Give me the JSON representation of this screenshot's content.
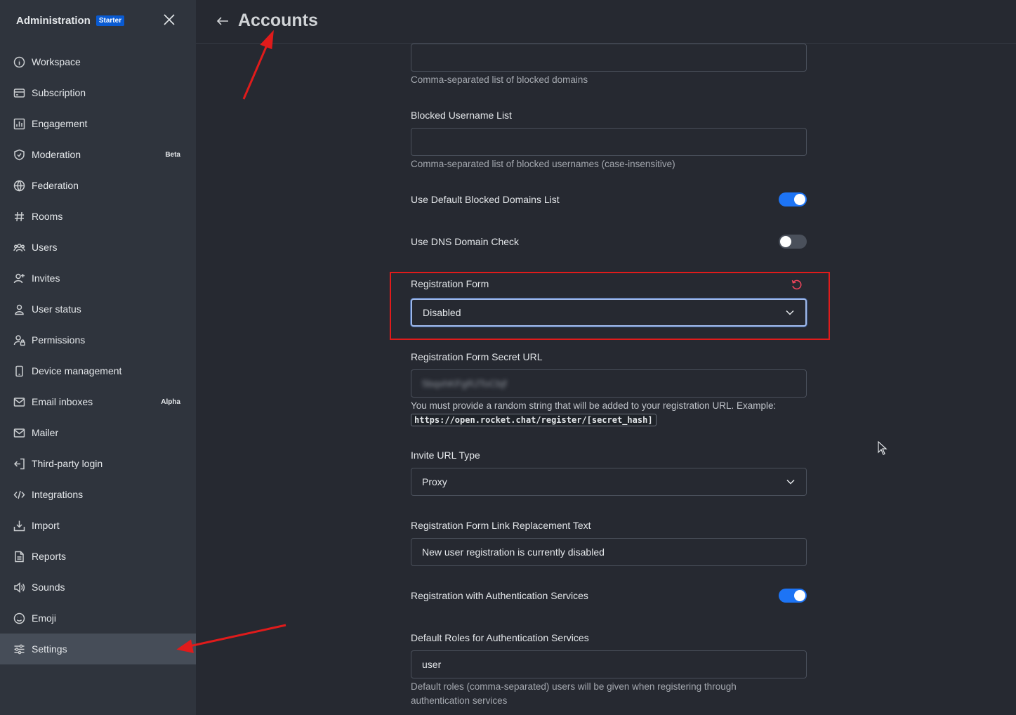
{
  "sidebar": {
    "title": "Administration",
    "badge": "Starter",
    "items": [
      {
        "label": "Workspace",
        "icon": "info-icon"
      },
      {
        "label": "Subscription",
        "icon": "card-icon"
      },
      {
        "label": "Engagement",
        "icon": "bar-chart-icon"
      },
      {
        "label": "Moderation",
        "icon": "shield-icon",
        "tag": "Beta"
      },
      {
        "label": "Federation",
        "icon": "globe-icon"
      },
      {
        "label": "Rooms",
        "icon": "hash-icon"
      },
      {
        "label": "Users",
        "icon": "team-icon"
      },
      {
        "label": "Invites",
        "icon": "user-plus-icon"
      },
      {
        "label": "User status",
        "icon": "user-icon"
      },
      {
        "label": "Permissions",
        "icon": "user-lock-icon"
      },
      {
        "label": "Device management",
        "icon": "mobile-icon"
      },
      {
        "label": "Email inboxes",
        "icon": "mail-icon",
        "tag": "Alpha"
      },
      {
        "label": "Mailer",
        "icon": "mail-icon"
      },
      {
        "label": "Third-party login",
        "icon": "login-icon"
      },
      {
        "label": "Integrations",
        "icon": "code-icon"
      },
      {
        "label": "Import",
        "icon": "import-icon"
      },
      {
        "label": "Reports",
        "icon": "document-icon"
      },
      {
        "label": "Sounds",
        "icon": "speaker-icon"
      },
      {
        "label": "Emoji",
        "icon": "emoji-icon"
      },
      {
        "label": "Settings",
        "icon": "sliders-icon",
        "active": true
      }
    ]
  },
  "header": {
    "title": "Accounts"
  },
  "settings": {
    "blocked_domains_hint": "Comma-separated list of blocked domains",
    "blocked_username_label": "Blocked Username List",
    "blocked_username_hint": "Comma-separated list of blocked usernames (case-insensitive)",
    "default_blocked_domains_label": "Use Default Blocked Domains List",
    "default_blocked_domains_on": true,
    "dns_check_label": "Use DNS Domain Check",
    "dns_check_on": false,
    "registration_form_label": "Registration Form",
    "registration_form_value": "Disabled",
    "secret_url_label": "Registration Form Secret URL",
    "secret_url_value": "5bqxhKFgRJToCbjf",
    "secret_url_hint": "You must provide a random string that will be added to your registration URL. Example:",
    "secret_url_example": "https://open.rocket.chat/register/[secret_hash]",
    "invite_url_type_label": "Invite URL Type",
    "invite_url_type_value": "Proxy",
    "link_replacement_label": "Registration Form Link Replacement Text",
    "link_replacement_value": "New user registration is currently disabled",
    "auth_services_label": "Registration with Authentication Services",
    "auth_services_on": true,
    "default_roles_label": "Default Roles for Authentication Services",
    "default_roles_value": "user",
    "default_roles_hint": "Default roles (comma-separated) users will be given when registering through authentication services"
  },
  "colors": {
    "accent": "#1d74f5",
    "highlight": "#e01b1b",
    "badge": "#095ad2"
  }
}
